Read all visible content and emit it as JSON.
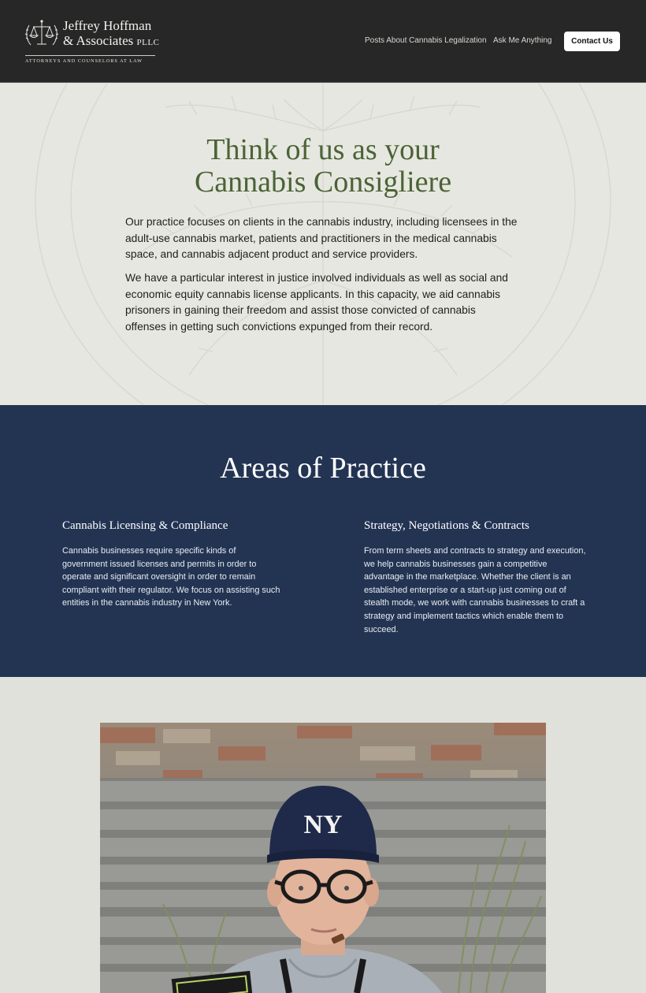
{
  "header": {
    "logo": {
      "name_line1": "Jeffrey Hoffman",
      "name_line2": "& Associates",
      "suffix": "PLLC",
      "tagline": "ATTORNEYS AND COUNSELORS AT LAW"
    },
    "nav": {
      "posts_label": "Posts About Cannabis Legalization",
      "ask_label": "Ask Me Anything",
      "contact_label": "Contact Us"
    }
  },
  "intro": {
    "headline_line1": "Think of us as your",
    "headline_line2": "Cannabis Consigliere",
    "paragraph1": "Our practice focuses on clients in the cannabis industry, including licensees in the adult-use cannabis market, patients and practitioners in the medical cannabis space, and cannabis adjacent product and service providers.",
    "paragraph2": "We have a particular interest in justice involved individuals as well as social and economic equity cannabis license applicants. In this capacity, we aid cannabis prisoners in gaining their freedom and assist those convicted of cannabis offenses in getting such convictions expunged from their record."
  },
  "practice": {
    "title": "Areas of Practice",
    "areas": [
      {
        "title": "Cannabis Licensing & Compliance",
        "body": "Cannabis businesses require specific kinds of government issued licenses and permits in order to operate and significant oversight in order to remain compliant with their regulator. We focus on assisting such entities in the cannabis industry in New York."
      },
      {
        "title": "Strategy, Negotiations & Contracts",
        "body": "From term sheets and contracts to strategy and execution, we help cannabis businesses gain a competitive advantage in the marketplace. Whether the client is an established enterprise or a start-up just coming out of stealth mode, we work with cannabis businesses to craft a strategy and implement tactics which enable them to succeed."
      }
    ]
  },
  "colors": {
    "header_bg": "#282727",
    "headline_green": "#4b6335",
    "practice_bg": "#233453",
    "page_bg": "#e3e3de"
  }
}
